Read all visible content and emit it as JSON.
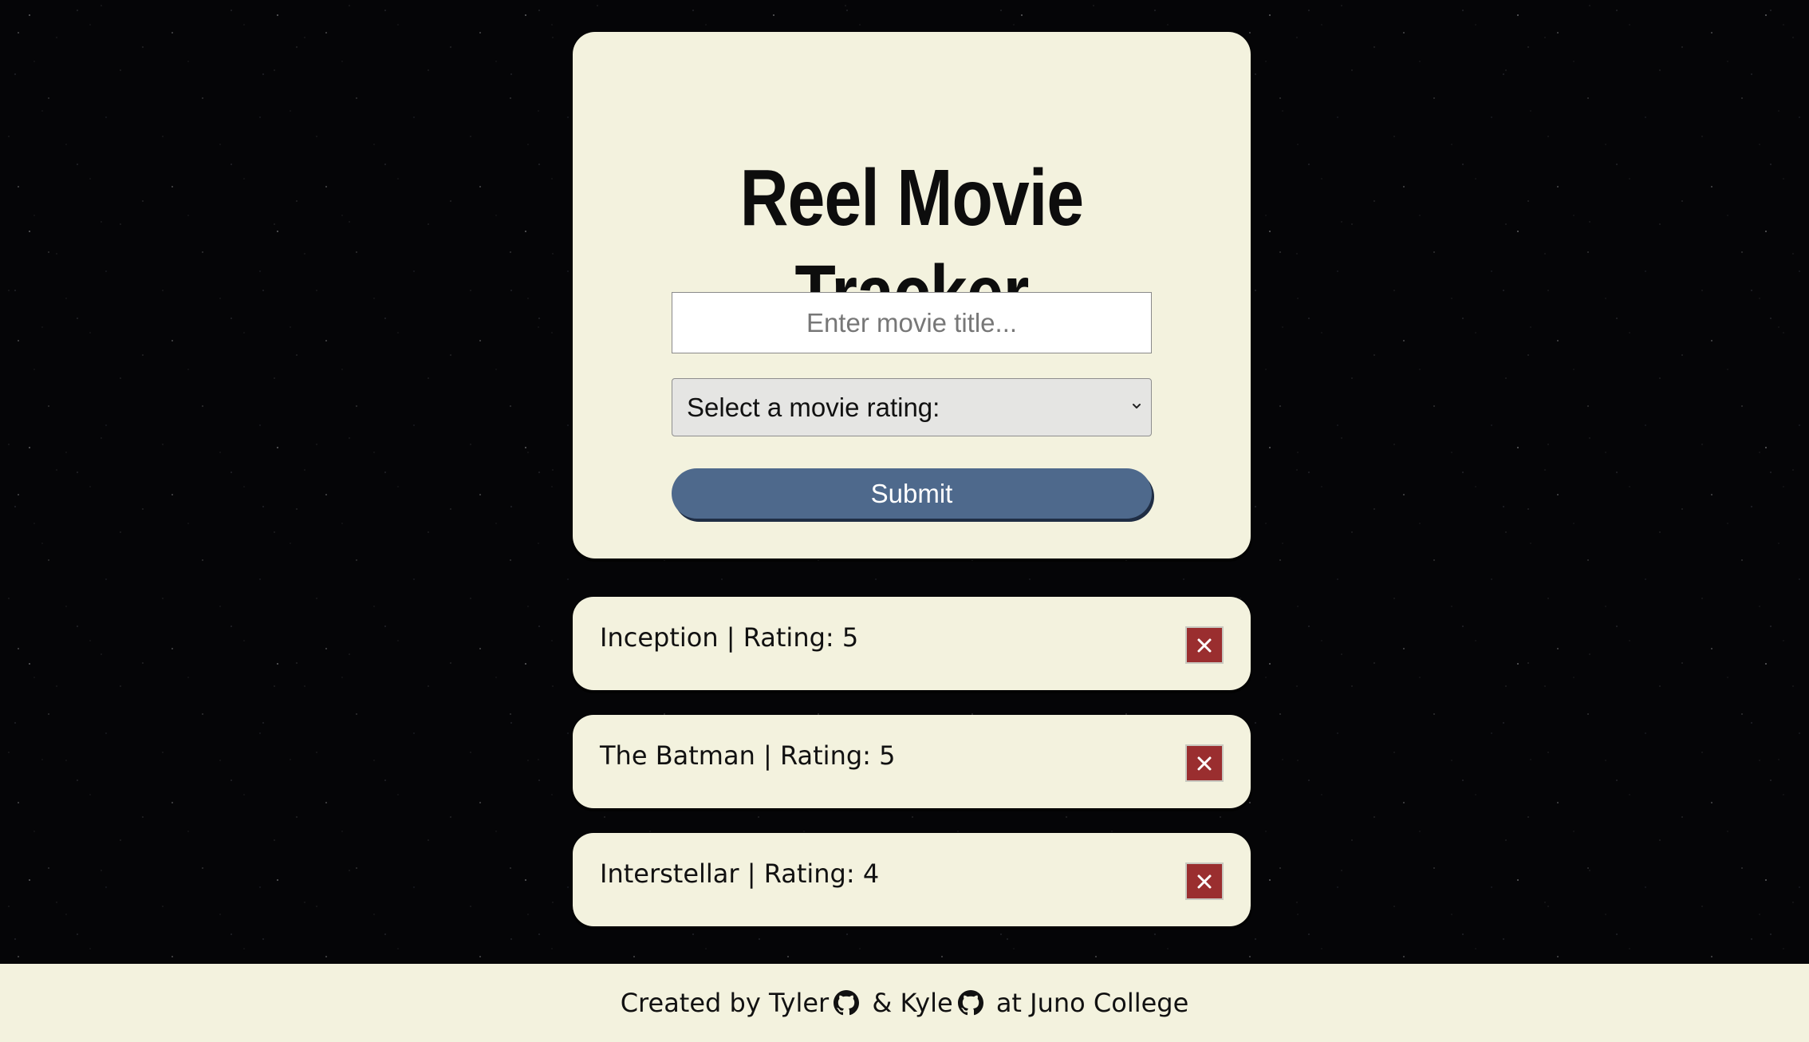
{
  "app": {
    "title": "Reel Movie Tracker"
  },
  "form": {
    "title_input": {
      "placeholder": "Enter movie title...",
      "value": ""
    },
    "rating_select": {
      "selected": "Select a movie rating:"
    },
    "submit_label": "Submit"
  },
  "movies": [
    {
      "label": "Inception | Rating: 5"
    },
    {
      "label": "The Batman | Rating: 5"
    },
    {
      "label": "Interstellar | Rating: 4"
    }
  ],
  "footer": {
    "prefix": "Created by ",
    "author1": "Tyler",
    "joiner": " & ",
    "author2": "Kyle",
    "suffix": " at Juno College"
  },
  "icons": {
    "delete": "close-icon",
    "github": "github-icon",
    "dropdown": "chevron-down-icon"
  },
  "colors": {
    "card_background": "#f3f2de",
    "submit_button": "#4e698c",
    "delete_button": "#9a2e2f",
    "page_background": "#050507"
  }
}
